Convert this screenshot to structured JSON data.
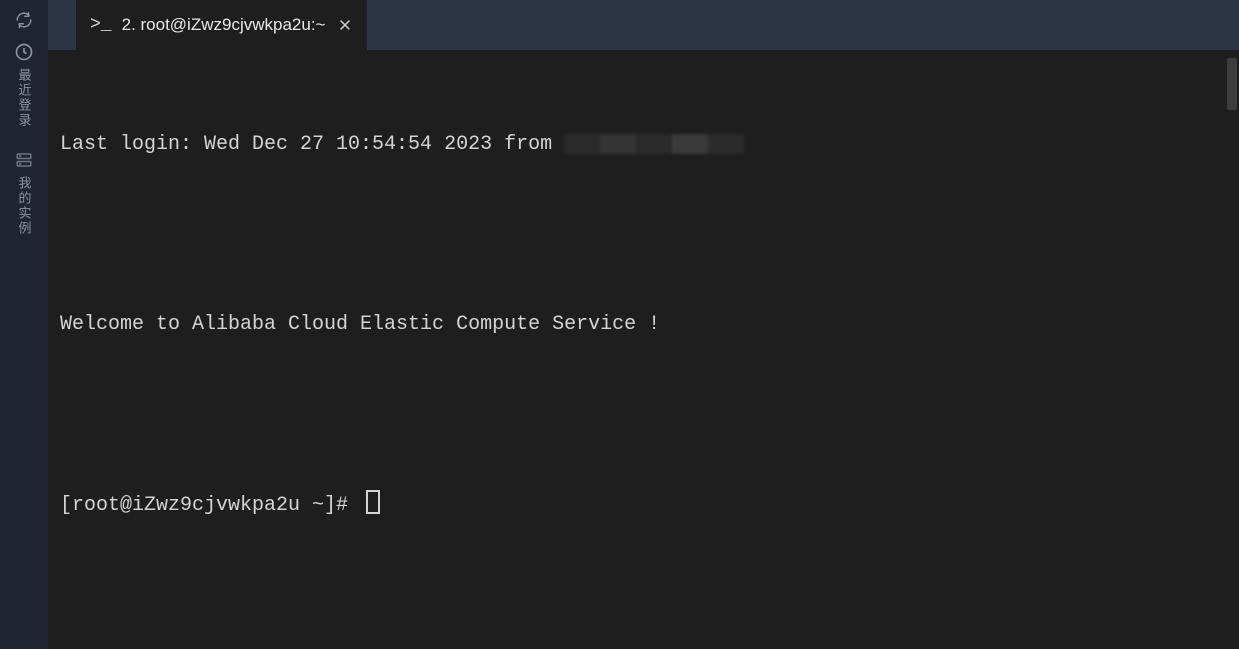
{
  "sidebar": {
    "items": [
      {
        "name": "refresh-icon",
        "label": ""
      },
      {
        "name": "recent-login-item",
        "label": "最近登录"
      },
      {
        "name": "my-instances-item",
        "label": "我的实例"
      }
    ]
  },
  "tabs": [
    {
      "prefix": ">_",
      "title": "2. root@iZwz9cjvwkpa2u:~"
    }
  ],
  "terminal": {
    "last_login_prefix": "Last login: Wed Dec 27 10:54:54 2023 from ",
    "welcome": "Welcome to Alibaba Cloud Elastic Compute Service !",
    "prompt": "[root@iZwz9cjvwkpa2u ~]# "
  }
}
